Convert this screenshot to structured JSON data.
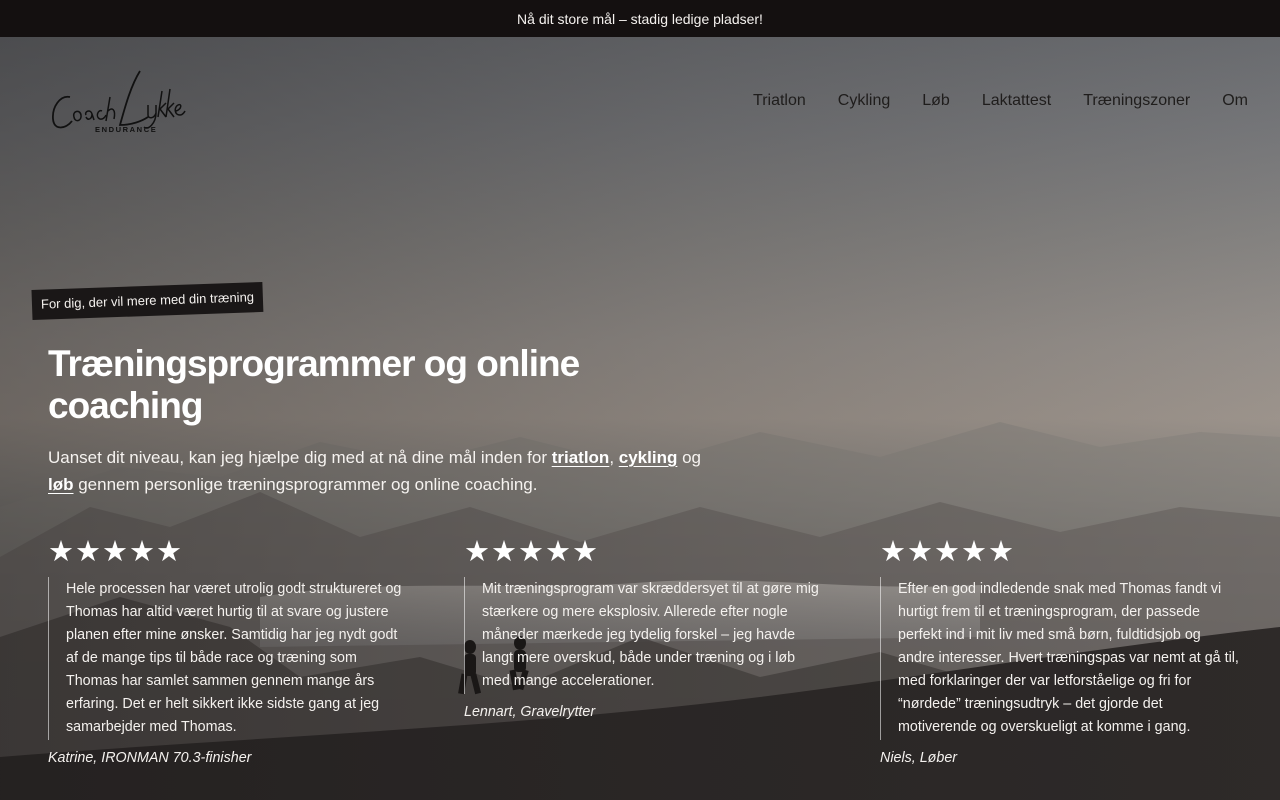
{
  "announcement": {
    "text": "Nå dit store mål – stadig ledige pladser!"
  },
  "brand": {
    "name_script": "Coach Lykke",
    "subtitle": "ENDURANCE"
  },
  "nav": {
    "items": [
      {
        "label": "Triatlon"
      },
      {
        "label": "Cykling"
      },
      {
        "label": "Løb"
      },
      {
        "label": "Laktattest"
      },
      {
        "label": "Træningszoner"
      },
      {
        "label": "Om"
      }
    ]
  },
  "hero": {
    "tagline": "For dig, der vil mere med din træning",
    "title": "Træningsprogrammer og online coaching",
    "intro": {
      "part1": "Uanset dit niveau, kan jeg hjælpe dig med at nå dine mål inden for ",
      "link1": "triatlon",
      "sep1": ", ",
      "link2": "cykling",
      "sep2": " og ",
      "link3": "løb",
      "part2": " gennem personlige træningsprogrammer og online coaching."
    }
  },
  "reviews": [
    {
      "rating": 5,
      "text": "Hele processen har været utrolig godt struktureret og Thomas har altid været hurtig til at svare og justere planen efter mine ønsker. Samtidig har jeg nydt godt af de mange tips til både race og træning som Thomas har samlet sammen gennem mange års erfaring. Det er helt sikkert ikke sidste gang at jeg samarbejder med Thomas.",
      "author": "Katrine, IRONMAN 70.3-finisher"
    },
    {
      "rating": 5,
      "text": "Mit træningsprogram var skræddersyet til at gøre mig stærkere og mere eksplosiv. Allerede efter nogle måneder mærkede jeg tydelig forskel – jeg havde langt mere overskud, både under træning og i løb med mange accelerationer.",
      "author": "Lennart, Gravelrytter"
    },
    {
      "rating": 5,
      "text": "Efter en god indledende snak med Thomas fandt vi hurtigt frem til et træningsprogram, der passede perfekt ind i mit liv med små børn, fuldtidsjob og andre interesser. Hvert træningspas var nemt at gå til, med forklaringer der var letforståelige og fri for “nørdede” træningsudtryk – det gjorde det motiverende og overskueligt at komme i gang.",
      "author": "Niels, Løber"
    }
  ],
  "colors": {
    "topbar": "#141010",
    "nav_text": "#1f1d1c",
    "tag_bg": "#1a1717"
  },
  "icons": {
    "star": "star-icon"
  }
}
